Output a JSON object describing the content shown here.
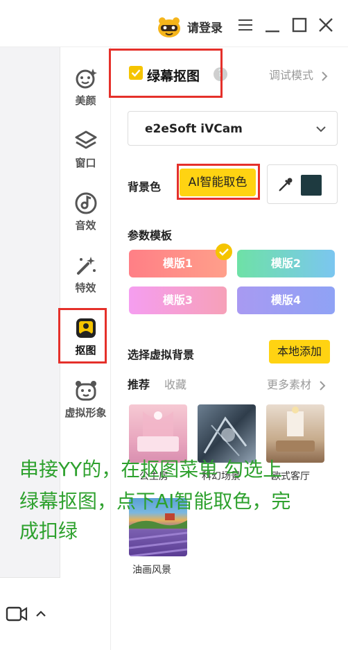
{
  "titlebar": {
    "login_label": "请登录",
    "icons": [
      "avatar-icon",
      "menu-icon",
      "minimize-icon",
      "maximize-icon",
      "close-icon"
    ]
  },
  "nav": {
    "items": [
      {
        "label": "美颜",
        "icon": "beauty-icon"
      },
      {
        "label": "窗口",
        "icon": "layers-icon"
      },
      {
        "label": "音效",
        "icon": "sound-icon"
      },
      {
        "label": "特效",
        "icon": "magic-wand-icon"
      },
      {
        "label": "抠图",
        "icon": "cutout-icon",
        "active": true
      },
      {
        "label": "虚拟形象",
        "icon": "avatar-face-icon"
      }
    ]
  },
  "panel": {
    "title": "绿幕抠图",
    "title_checked": true,
    "help_glyph": "?",
    "debug_mode_label": "调试模式",
    "device_select": {
      "value": "e2eSoft iVCam"
    },
    "bg_color_label": "背景色",
    "ai_pick_button": "AI智能取色",
    "picked_color": "#1e3a40",
    "param_template_label": "参数模板",
    "templates": [
      {
        "label": "模版1",
        "selected": true
      },
      {
        "label": "模版2"
      },
      {
        "label": "模版3"
      },
      {
        "label": "模版4"
      }
    ],
    "virtual_bg_label": "选择虚拟背景",
    "add_local_button": "本地添加",
    "tabs": [
      {
        "label": "推荐",
        "active": true
      },
      {
        "label": "收藏"
      }
    ],
    "more_label": "更多素材",
    "backgrounds": [
      {
        "caption": "公主房"
      },
      {
        "caption": "科幻场景"
      },
      {
        "caption": "欧式客厅"
      },
      {
        "caption": "油画风景"
      }
    ]
  },
  "annotation": {
    "lines": [
      "串接YY的，在抠图菜单 勾选上",
      "绿幕抠图，点下AI智能取色，完",
      "成扣绿"
    ]
  },
  "colors": {
    "accent": "#ffd312",
    "annotation_red": "#e5302a",
    "annotation_green": "#2ea12e"
  }
}
